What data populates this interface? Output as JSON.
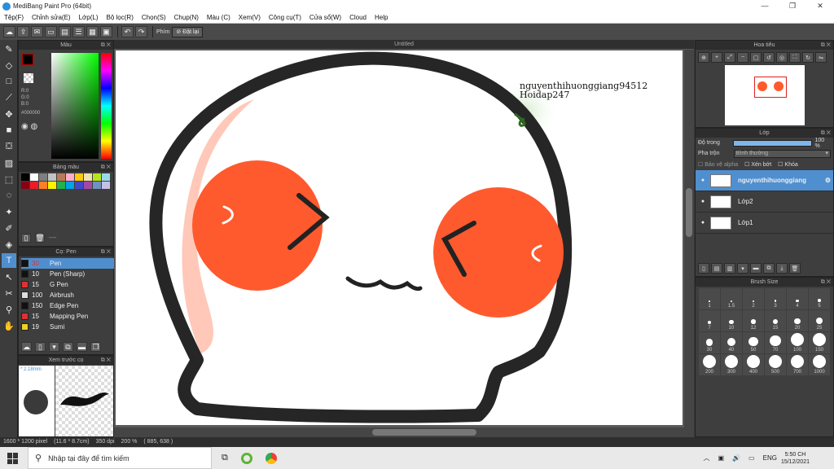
{
  "window": {
    "title": "MediBang Paint Pro (64bit)",
    "minimize": "—",
    "restore": "❐",
    "close": "✕"
  },
  "menu": [
    "Tệp(F)",
    "Chỉnh sửa(E)",
    "Lớp(L)",
    "Bộ lọc(R)",
    "Chọn(S)",
    "Chụp(N)",
    "Màu (C)",
    "Xem(V)",
    "Công cụ(T)",
    "Cửa sổ(W)",
    "Cloud",
    "Help"
  ],
  "toolbar": {
    "keys_label": "Phím",
    "reset_label": "Đặt lại"
  },
  "panels": {
    "color": "Màu",
    "palette": "Bảng màu",
    "brush": "Cọ: Pen",
    "preview": "Xem trước cọ",
    "navigator": "Hoa tiêu",
    "layer": "Lớp",
    "brush_size": "Brush Size",
    "untitled": "Untitled"
  },
  "color": {
    "primary": "#c00000",
    "hex": "#000000",
    "r": "R:0",
    "g": "G:0",
    "b": "B:0"
  },
  "palette_label": "----",
  "palette_colors": [
    "#000000",
    "#ffffff",
    "#7f7f7f",
    "#c3c3c3",
    "#b97a57",
    "#ffaec9",
    "#ffc90e",
    "#efe4b0",
    "#b5e61d",
    "#99d9ea",
    "#880015",
    "#ed1c24",
    "#ff7f27",
    "#fff200",
    "#22b14c",
    "#00a2e8",
    "#3f48cc",
    "#a349a4",
    "#7092be",
    "#c8bfe7"
  ],
  "brushes": [
    {
      "size": "30",
      "name": "Pen",
      "color": "#111111",
      "selected": true
    },
    {
      "size": "10",
      "name": "Pen (Sharp)",
      "color": "#111111"
    },
    {
      "size": "15",
      "name": "G Pen",
      "color": "#e03030"
    },
    {
      "size": "100",
      "name": "Airbrush",
      "color": "#dddddd"
    },
    {
      "size": "150",
      "name": "Edge Pen",
      "color": "#111111"
    },
    {
      "size": "15",
      "name": "Mapping Pen",
      "color": "#e03030"
    },
    {
      "size": "19",
      "name": "Sumi",
      "color": "#f0d020"
    }
  ],
  "preview": {
    "size": "2.18mm"
  },
  "layer": {
    "opacity_label": "Độ trong",
    "opacity_value": "100 %",
    "blend_label": "Pha trộn",
    "blend_value": "Bình thường",
    "protect_alpha": "Bảo vệ alpha",
    "clipping": "Xén bớt",
    "lock": "Khóa",
    "opacity_fraction": 1.0,
    "layers": [
      {
        "name": "nguyenthihuonggiang",
        "selected": true
      },
      {
        "name": "Lớp2",
        "selected": false
      },
      {
        "name": "Lớp1",
        "selected": false
      }
    ]
  },
  "brush_sizes": [
    "1",
    "1.5",
    "2",
    "3",
    "4",
    "5",
    "7",
    "10",
    "12",
    "15",
    "20",
    "25",
    "30",
    "40",
    "50",
    "70",
    "100",
    "150",
    "200",
    "300",
    "400",
    "500",
    "700",
    "1000"
  ],
  "watermark": {
    "line1": "nguyenthihuonggiang94512",
    "line2": "Hoidap247"
  },
  "status": {
    "pixels": "1600 * 1200 pixel",
    "size": "(11.6 * 8.7cm)",
    "dpi": "350 dpi",
    "zoom": "200 %",
    "coords": "( 885, 638 )"
  },
  "taskbar": {
    "search_placeholder": "Nhập tại đây để tìm kiếm",
    "lang": "ENG",
    "time": "5:50 CH",
    "date": "15/12/2021"
  }
}
